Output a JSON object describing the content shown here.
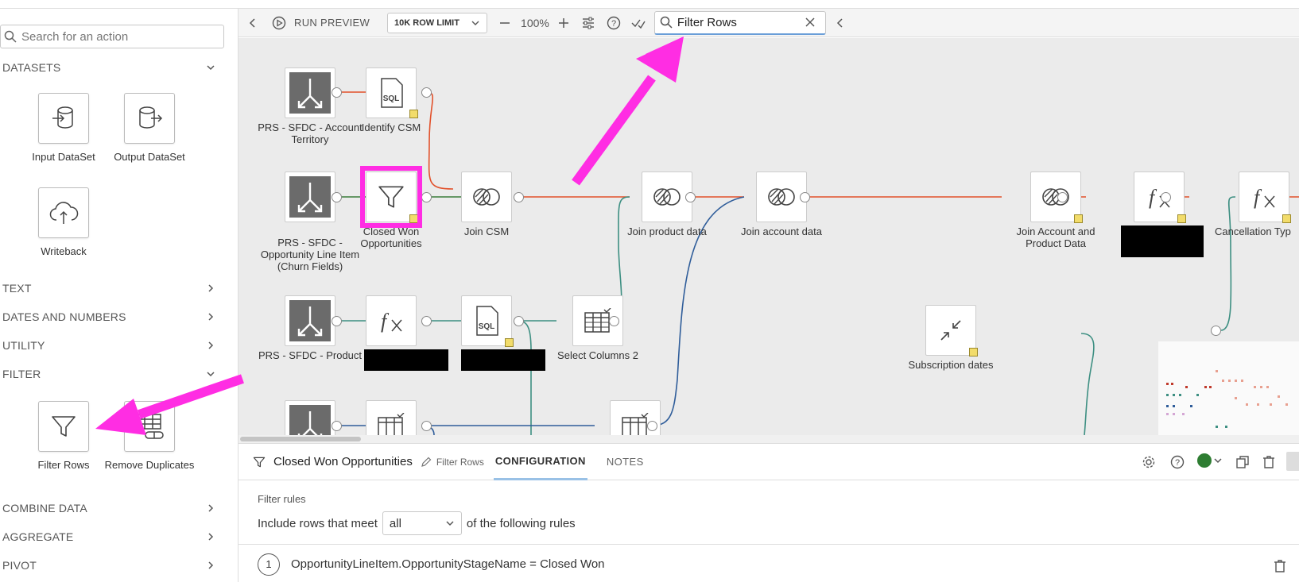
{
  "left_panel": {
    "search_placeholder": "Search for an action",
    "sections": {
      "datasets": "DATASETS",
      "text": "TEXT",
      "dates_numbers": "DATES AND NUMBERS",
      "utility": "UTILITY",
      "filter": "FILTER",
      "combine": "COMBINE DATA",
      "aggregate": "AGGREGATE",
      "pivot": "PIVOT"
    },
    "tiles": {
      "input_dataset": "Input DataSet",
      "output_dataset": "Output DataSet",
      "writeback": "Writeback",
      "filter_rows": "Filter Rows",
      "remove_duplicates": "Remove Duplicates"
    }
  },
  "toolbar": {
    "run_preview": "RUN PREVIEW",
    "row_limit": "10K ROW LIMIT",
    "zoom": "100%",
    "search_value": "Filter Rows"
  },
  "nodes": {
    "prs_account_territory": "PRS - SFDC - Account Territory",
    "identify_csm": "Identify CSM",
    "prs_opportunity": "PRS - SFDC - Opportunity Line Item (Churn Fields)",
    "closed_won": "Closed Won Opportunities",
    "join_csm": "Join CSM",
    "join_product": "Join product data",
    "join_account": "Join account data",
    "join_account_product": "Join Account and Product Data",
    "cancellation": "Cancellation Typ",
    "prs_product": "PRS - SFDC - Product",
    "select_columns_2": "Select Columns 2",
    "subscription_dates": "Subscription dates"
  },
  "bottom": {
    "title": "Closed Won Opportunities",
    "subtitle": "Filter Rows",
    "tab_config": "CONFIGURATION",
    "tab_notes": "NOTES",
    "filter_rules": "Filter rules",
    "include_prefix": "Include rows that meet",
    "match_value": "all",
    "include_suffix": "of the following rules",
    "rule_number": "1",
    "rule_text": "OpportunityLineItem.OpportunityStageName = Closed Won"
  },
  "colors": {
    "accent_magenta": "#ff2de3",
    "wire_red": "#e2512b",
    "wire_green": "#3a7d3a",
    "wire_teal": "#3d8f82",
    "wire_blue": "#2f5d9a",
    "status_green": "#2e7d32"
  }
}
